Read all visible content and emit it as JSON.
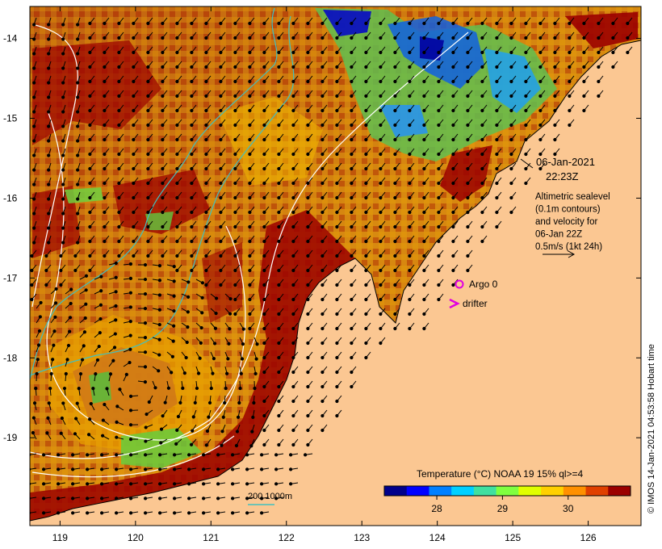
{
  "map": {
    "x_ticks": [
      "119",
      "120",
      "121",
      "122",
      "123",
      "124",
      "125",
      "126"
    ],
    "y_ticks": [
      "-14",
      "-15",
      "-16",
      "-17",
      "-18",
      "-19"
    ],
    "x_range": [
      118.6,
      126.7
    ],
    "y_range": [
      -20.1,
      -13.6
    ]
  },
  "annotation": {
    "date": "06-Jan-2021",
    "time": "22:23Z",
    "altimetry_lines": [
      "Altimetric sealevel",
      "(0.1m contours)",
      "and velocity for",
      "06-Jan 22Z",
      "0.5m/s (1kt 24h)"
    ]
  },
  "legend": {
    "argo_label": "Argo 0",
    "drifter_label": "drifter",
    "argo_color": "#e000e0",
    "drifter_color": "#e000e0"
  },
  "depth_contour_label": "200  1000m",
  "colorbar": {
    "title": "Temperature (°C) NOAA 19 15% ql>=4",
    "ticks": [
      "28",
      "29",
      "30"
    ],
    "tick_values": [
      28,
      29,
      30
    ],
    "range": [
      27.2,
      30.95
    ],
    "colors": [
      "#00008b",
      "#0000ff",
      "#0080ff",
      "#00d0ff",
      "#40e0a0",
      "#80ff40",
      "#e0ff00",
      "#ffd000",
      "#ff9000",
      "#e04000",
      "#9b0000"
    ]
  },
  "credit": "© IMOS 14-Jan-2021 04:53:58 Hobart time",
  "colors": {
    "land": "#fbc792",
    "sea_warm": "#d4880c",
    "sea_hot": "#9b0000",
    "coastline": "#000000",
    "contour": "#ffffff",
    "bathy": "#40c0c0"
  }
}
